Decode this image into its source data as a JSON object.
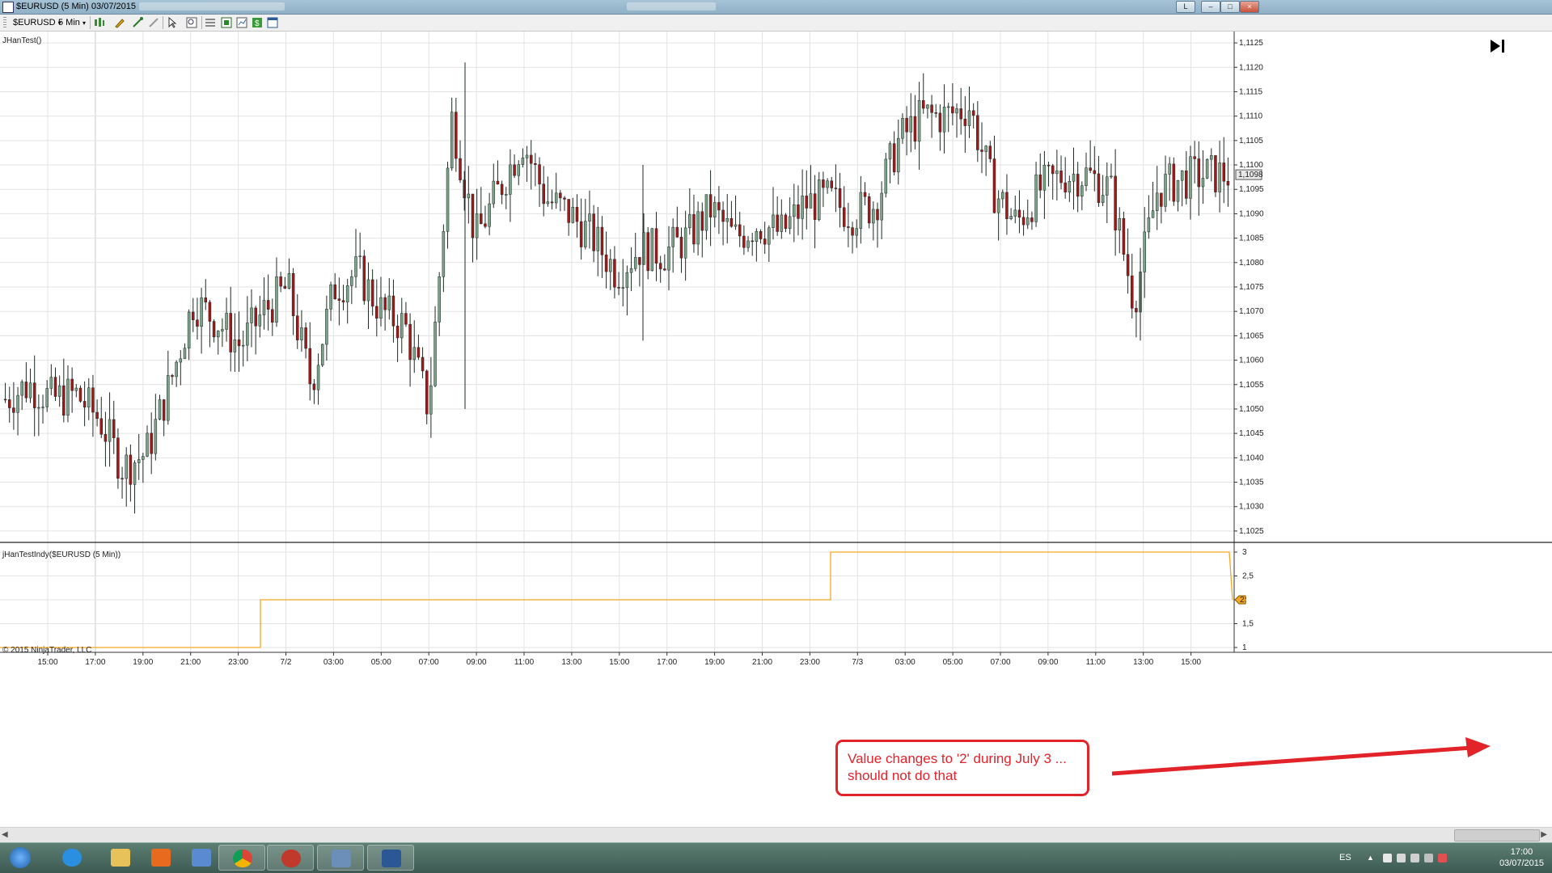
{
  "window": {
    "title": "$EURUSD (5 Min)  03/07/2015",
    "controls": [
      "L",
      "–",
      "□",
      "×"
    ]
  },
  "toolbar": {
    "instrument": "$EURUSD",
    "interval": "5 Min"
  },
  "panels": {
    "price_label": "JHanTest()",
    "indicator_label": "jHanTestIndy($EURUSD (5 Min))",
    "copyright": "© 2015 NinjaTrader, LLC",
    "current_price": "1,1098",
    "current_indicator": "2"
  },
  "callout": {
    "line1": "Value changes to '2' during July 3 ...",
    "line2": "should not do that"
  },
  "taskbar": {
    "lang": "ES",
    "time": "17:00",
    "date": "03/07/2015"
  },
  "colors": {
    "up_candle": "#7aa38a",
    "down_candle": "#a01818",
    "wick": "#1e2a24",
    "indicator_line": "#f5a623",
    "callout": "#e3232a",
    "grid": "#e3e3e3"
  },
  "chart_data": [
    {
      "type": "line",
      "title": "JHanTest()",
      "x_tick_labels": [
        "15:00",
        "17:00",
        "19:00",
        "21:00",
        "23:00",
        "7/2",
        "03:00",
        "05:00",
        "07:00",
        "09:00",
        "11:00",
        "13:00",
        "15:00",
        "17:00",
        "19:00",
        "21:00",
        "23:00",
        "7/3",
        "03:00",
        "05:00",
        "07:00",
        "09:00",
        "11:00",
        "13:00",
        "15:00"
      ],
      "y_tick_labels": [
        "1,1125",
        "1,1120",
        "1,1115",
        "1,1110",
        "1,1105",
        "1,1100",
        "1,1095",
        "1,1090",
        "1,1085",
        "1,1080",
        "1,1075",
        "1,1070",
        "1,1065",
        "1,1060",
        "1,1055",
        "1,1050",
        "1,1045",
        "1,1040",
        "1,1035",
        "1,1030",
        "1,1025"
      ],
      "ylim": [
        1.1023,
        1.1127
      ],
      "series": [
        {
          "name": "$EURUSD",
          "x": [
            "15:00",
            "16:00",
            "17:00",
            "18:00",
            "19:00",
            "20:00",
            "21:00",
            "22:00",
            "23:00",
            "7/2",
            "01:00",
            "02:00",
            "03:00",
            "04:00",
            "05:00",
            "06:00",
            "07:00",
            "08:00",
            "08:30",
            "08:45",
            "09:00",
            "10:00",
            "11:00",
            "12:00",
            "13:00",
            "14:00",
            "15:00",
            "16:00",
            "17:00",
            "18:00",
            "19:00",
            "20:00",
            "21:00",
            "22:00",
            "23:00",
            "7/3",
            "01:00",
            "02:00",
            "03:00",
            "04:00",
            "05:00",
            "06:00",
            "07:00",
            "08:00",
            "09:00",
            "10:00",
            "11:00",
            "12:00",
            "13:00",
            "14:00",
            "15:00",
            "16:00",
            "16:50"
          ],
          "values": [
            1.1052,
            1.1055,
            1.1052,
            1.1053,
            1.1048,
            1.1038,
            1.1041,
            1.1055,
            1.1072,
            1.1068,
            1.1063,
            1.107,
            1.1075,
            1.1055,
            1.1075,
            1.1078,
            1.107,
            1.1067,
            1.105,
            1.111,
            1.1085,
            1.1095,
            1.1105,
            1.1093,
            1.109,
            1.1085,
            1.1078,
            1.1083,
            1.1082,
            1.1085,
            1.1091,
            1.1085,
            1.1088,
            1.1086,
            1.1092,
            1.1093,
            1.109,
            1.1092,
            1.1105,
            1.111,
            1.111,
            1.1112,
            1.1095,
            1.1088,
            1.1095,
            1.1098,
            1.1098,
            1.1095,
            1.1072,
            1.1095,
            1.1097,
            1.1098,
            1.1098
          ]
        }
      ]
    },
    {
      "type": "line",
      "title": "jHanTestIndy($EURUSD (5 Min))",
      "y_tick_labels": [
        "3",
        "2,5",
        "2",
        "1,5",
        "1"
      ],
      "ylim": [
        1,
        3
      ],
      "series": [
        {
          "name": "jHanTestIndy",
          "x": [
            "15:00",
            "23:55",
            "23:56",
            "23:55(7/2)",
            "23:56(7/2)",
            "16:55",
            "17:00"
          ],
          "values": [
            1,
            1,
            2,
            2,
            3,
            3,
            2
          ]
        }
      ]
    }
  ]
}
